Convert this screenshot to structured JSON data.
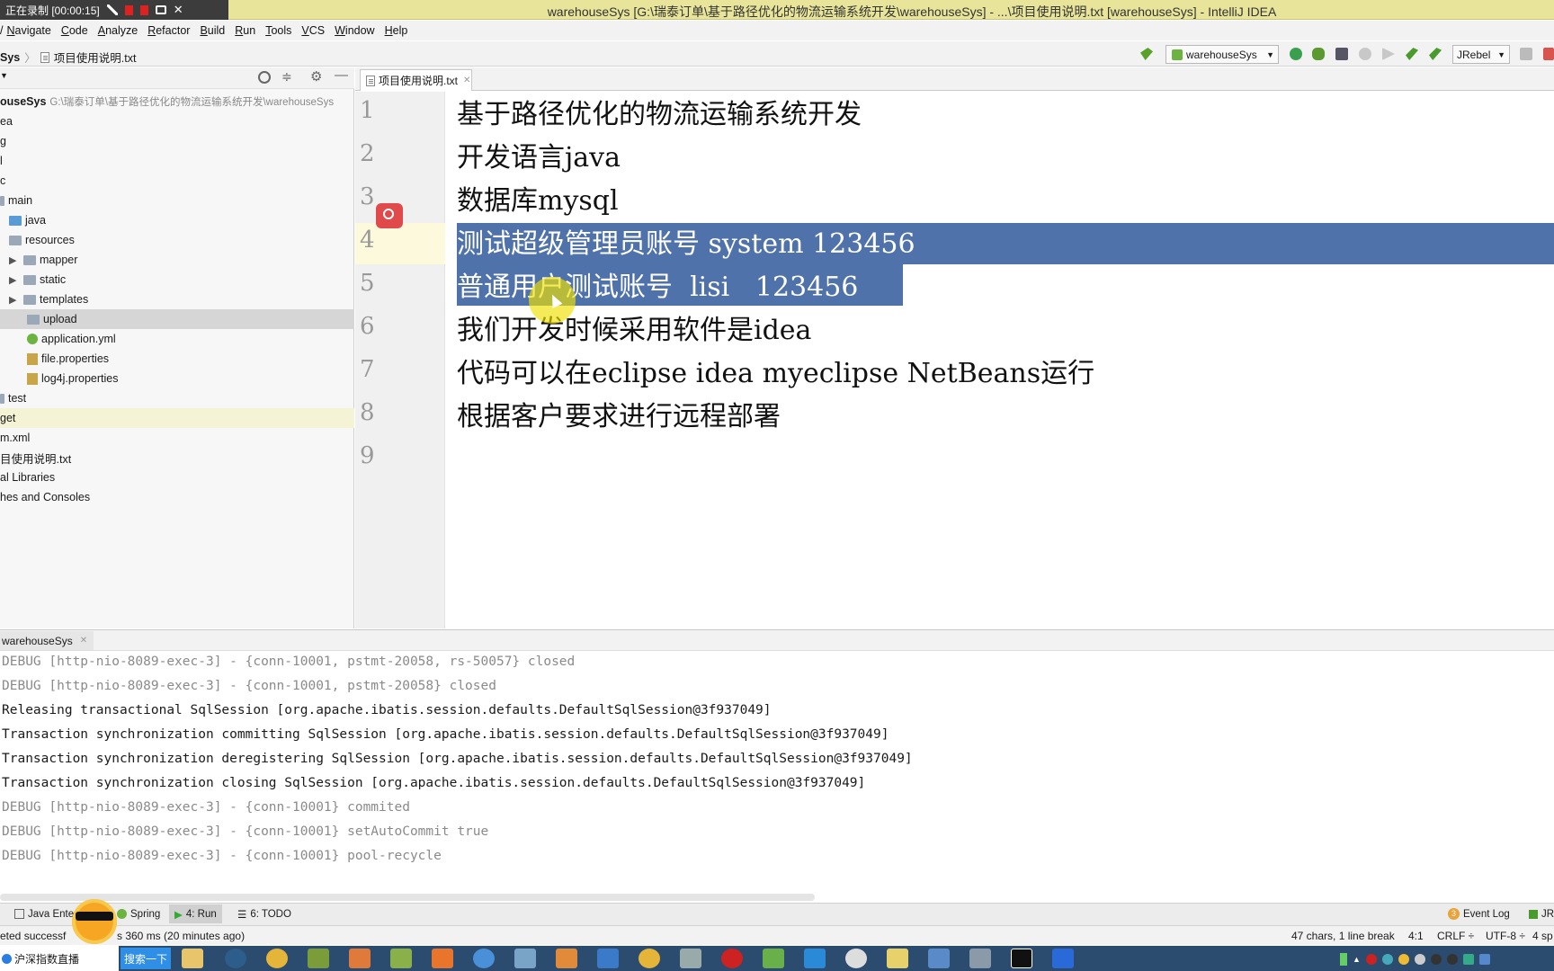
{
  "recorder": {
    "label": "正在录制 [00:00:15]"
  },
  "window_title": "warehouseSys [G:\\瑞泰订单\\基于路径优化的物流运输系统开发\\warehouseSys] - ...\\项目使用说明.txt [warehouseSys] - IntelliJ IDEA",
  "menu": [
    "Navigate",
    "Code",
    "Analyze",
    "Refactor",
    "Build",
    "Run",
    "Tools",
    "VCS",
    "Window",
    "Help"
  ],
  "breadcrumb": {
    "project": "Sys",
    "file": "项目使用说明.txt"
  },
  "toolbar": {
    "run_config": "warehouseSys",
    "jrebel": "JRebel"
  },
  "project_tree": {
    "root_name": "ouseSys",
    "root_path": "G:\\瑞泰订单\\基于路径优化的物流运输系统开发\\warehouseSys",
    "rows": [
      "ea",
      "g",
      "l",
      "c",
      "main",
      "java",
      "resources",
      "mapper",
      "static",
      "templates",
      "upload",
      "application.yml",
      "file.properties",
      "log4j.properties",
      "test",
      "get",
      "m.xml",
      "目使用说明.txt",
      "al Libraries",
      "hes and Consoles"
    ]
  },
  "editor": {
    "tab_label": "项目使用说明.txt",
    "line_numbers": [
      "1",
      "2",
      "3",
      "4",
      "5",
      "6",
      "7",
      "8",
      "9"
    ],
    "lines": [
      "基于路径优化的物流运输系统开发",
      "开发语言java",
      "数据库mysql",
      "测试超级管理员账号 system 123456",
      "普通用户测试账号  lisi   123456",
      "我们开发时候采用软件是idea",
      "代码可以在eclipse idea myeclipse NetBeans运行",
      "根据客户要求进行远程部署",
      ""
    ]
  },
  "run_panel": {
    "tab_label": "warehouseSys",
    "console_lines": [
      "DEBUG [http-nio-8089-exec-3] - {conn-10001, pstmt-20058, rs-50057} closed",
      "DEBUG [http-nio-8089-exec-3] - {conn-10001, pstmt-20058} closed",
      "Releasing transactional SqlSession [org.apache.ibatis.session.defaults.DefaultSqlSession@3f937049]",
      "Transaction synchronization committing SqlSession [org.apache.ibatis.session.defaults.DefaultSqlSession@3f937049]",
      "Transaction synchronization deregistering SqlSession [org.apache.ibatis.session.defaults.DefaultSqlSession@3f937049]",
      "Transaction synchronization closing SqlSession [org.apache.ibatis.session.defaults.DefaultSqlSession@3f937049]",
      "DEBUG [http-nio-8089-exec-3] - {conn-10001} commited",
      "DEBUG [http-nio-8089-exec-3] - {conn-10001} setAutoCommit true",
      "DEBUG [http-nio-8089-exec-3] - {conn-10001} pool-recycle"
    ]
  },
  "tool_tabs": {
    "java_ent": "Java Ente",
    "spring": "Spring",
    "run": "4: Run",
    "todo": "6: TODO",
    "event_log": "Event Log",
    "event_count": "3",
    "jr": "JR"
  },
  "status": {
    "message_left": "eted successf",
    "message_right": "s 360 ms (20 minutes ago)",
    "chars": "47 chars, 1 line break",
    "position": "4:1",
    "line_sep": "CRLF ÷",
    "encoding": "UTF-8 ÷",
    "indent": "4 sp"
  },
  "taskbar": {
    "app_label": "沪深指数直播",
    "search_label": "搜索一下"
  }
}
